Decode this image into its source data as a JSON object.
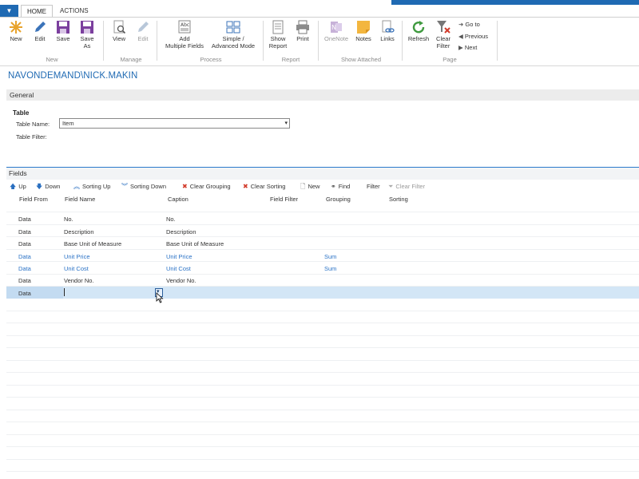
{
  "header": {
    "app_menu_icon": "dropdown-arrow-icon",
    "tabs": [
      {
        "label": "HOME"
      },
      {
        "label": "ACTIONS"
      }
    ]
  },
  "ribbon": {
    "groups": [
      {
        "label": "New",
        "buttons": [
          {
            "label": "New",
            "icon": "sun-new-icon"
          },
          {
            "label": "Edit",
            "icon": "pencil-icon"
          },
          {
            "label": "Save",
            "icon": "save-icon"
          },
          {
            "label": "Save\nAs",
            "icon": "save-as-icon"
          }
        ]
      },
      {
        "label": "Manage",
        "buttons": [
          {
            "label": "View",
            "icon": "view-icon"
          },
          {
            "label": "Edit",
            "icon": "edit-icon",
            "disabled": true
          }
        ]
      },
      {
        "label": "Process",
        "buttons": [
          {
            "label": "Add\nMultiple Fields",
            "icon": "add-fields-icon"
          },
          {
            "label": "Simple /\nAdvanced Mode",
            "icon": "mode-icon"
          }
        ]
      },
      {
        "label": "Report",
        "buttons": [
          {
            "label": "Show\nReport",
            "icon": "report-icon"
          },
          {
            "label": "Print",
            "icon": "printer-icon"
          }
        ]
      },
      {
        "label": "Show Attached",
        "buttons": [
          {
            "label": "OneNote",
            "icon": "onenote-icon",
            "disabled": true
          },
          {
            "label": "Notes",
            "icon": "notes-icon"
          },
          {
            "label": "Links",
            "icon": "links-icon"
          }
        ]
      },
      {
        "label": "Page",
        "buttons": [
          {
            "label": "Refresh",
            "icon": "refresh-icon"
          },
          {
            "label": "Clear\nFilter",
            "icon": "clear-filter-icon"
          }
        ],
        "nav": [
          {
            "label": "Go to"
          },
          {
            "label": "Previous"
          },
          {
            "label": "Next"
          }
        ]
      }
    ]
  },
  "user": {
    "name": "NAVONDEMAND\\NICK.MAKIN"
  },
  "general": {
    "title": "General",
    "subheading": "Table",
    "table_name_label": "Table Name:",
    "table_name_value": "Item",
    "table_filter_label": "Table Filter:"
  },
  "fields": {
    "title": "Fields",
    "toolbar": [
      {
        "label": "Up",
        "icon": "arrow-up-icon"
      },
      {
        "label": "Down",
        "icon": "arrow-down-icon"
      },
      {
        "label": "Sorting Up",
        "icon": "double-chevron-up-icon"
      },
      {
        "label": "Sorting Down",
        "icon": "double-chevron-down-icon"
      },
      {
        "label": "Clear Grouping",
        "icon": "red-x-icon"
      },
      {
        "label": "Clear Sorting",
        "icon": "red-x-icon"
      },
      {
        "label": "New",
        "icon": "new-doc-icon"
      },
      {
        "label": "Find",
        "icon": "binoculars-icon"
      },
      {
        "label": "Filter",
        "icon": ""
      },
      {
        "label": "Clear Filter",
        "icon": "clear-filter-icon",
        "disabled": true
      }
    ],
    "columns": [
      "Field From",
      "Field Name",
      "Caption",
      "Field Filter",
      "Grouping",
      "Sorting"
    ],
    "rows": [
      {
        "from": "Data",
        "name": "No.",
        "caption": "No.",
        "filter": "",
        "grouping": "",
        "sorting": "",
        "highlight": false
      },
      {
        "from": "Data",
        "name": "Description",
        "caption": "Description",
        "filter": "",
        "grouping": "",
        "sorting": "",
        "highlight": false
      },
      {
        "from": "Data",
        "name": "Base Unit of Measure",
        "caption": "Base Unit of Measure",
        "filter": "",
        "grouping": "",
        "sorting": "",
        "highlight": false
      },
      {
        "from": "Data",
        "name": "Unit Price",
        "caption": "Unit Price",
        "filter": "",
        "grouping": "Sum",
        "sorting": "",
        "highlight": true
      },
      {
        "from": "Data",
        "name": "Unit Cost",
        "caption": "Unit Cost",
        "filter": "",
        "grouping": "Sum",
        "sorting": "",
        "highlight": true
      },
      {
        "from": "Data",
        "name": "Vendor No.",
        "caption": "Vendor No.",
        "filter": "",
        "grouping": "",
        "sorting": "",
        "highlight": false
      },
      {
        "from": "Data",
        "name": "",
        "caption": "",
        "filter": "",
        "grouping": "",
        "sorting": "",
        "highlight": false
      }
    ]
  },
  "colors": {
    "accent": "#1f6ab3",
    "link_blue": "#2a72c6",
    "selected_row": "#d3e6f6"
  }
}
